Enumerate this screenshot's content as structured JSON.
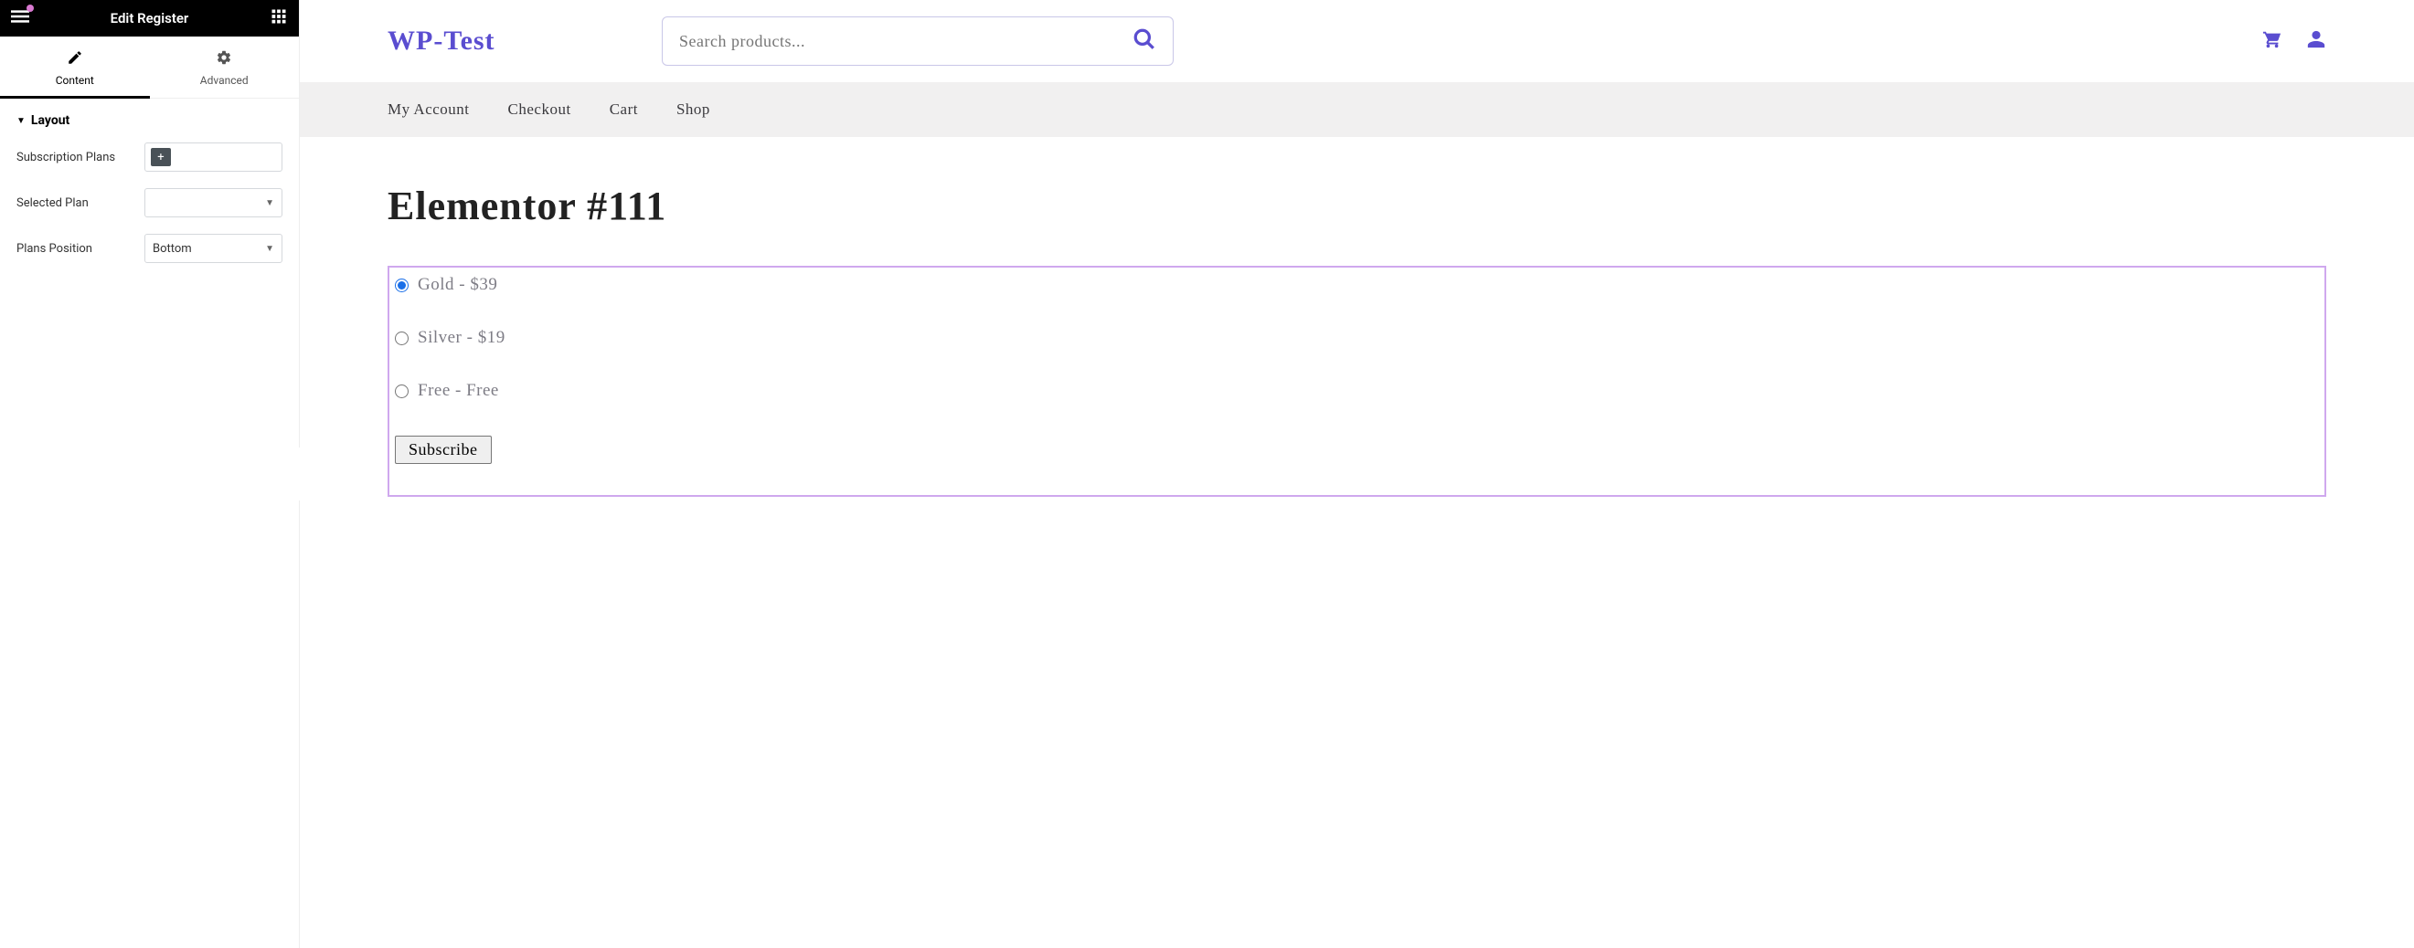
{
  "panel": {
    "title": "Edit Register",
    "tabs": {
      "content": "Content",
      "advanced": "Advanced"
    },
    "section_layout": "Layout",
    "controls": {
      "subscription_plans_label": "Subscription Plans",
      "selected_plan_label": "Selected Plan",
      "selected_plan_value": "",
      "plans_position_label": "Plans Position",
      "plans_position_value": "Bottom"
    }
  },
  "site": {
    "title": "WP-Test",
    "search_placeholder": "Search products...",
    "nav": {
      "my_account": "My Account",
      "checkout": "Checkout",
      "cart": "Cart",
      "shop": "Shop"
    }
  },
  "page": {
    "heading": "Elementor #111",
    "plans": [
      {
        "label": "Gold - $39",
        "checked": true
      },
      {
        "label": "Silver - $19",
        "checked": false
      },
      {
        "label": "Free - Free",
        "checked": false
      }
    ],
    "subscribe_label": "Subscribe"
  }
}
